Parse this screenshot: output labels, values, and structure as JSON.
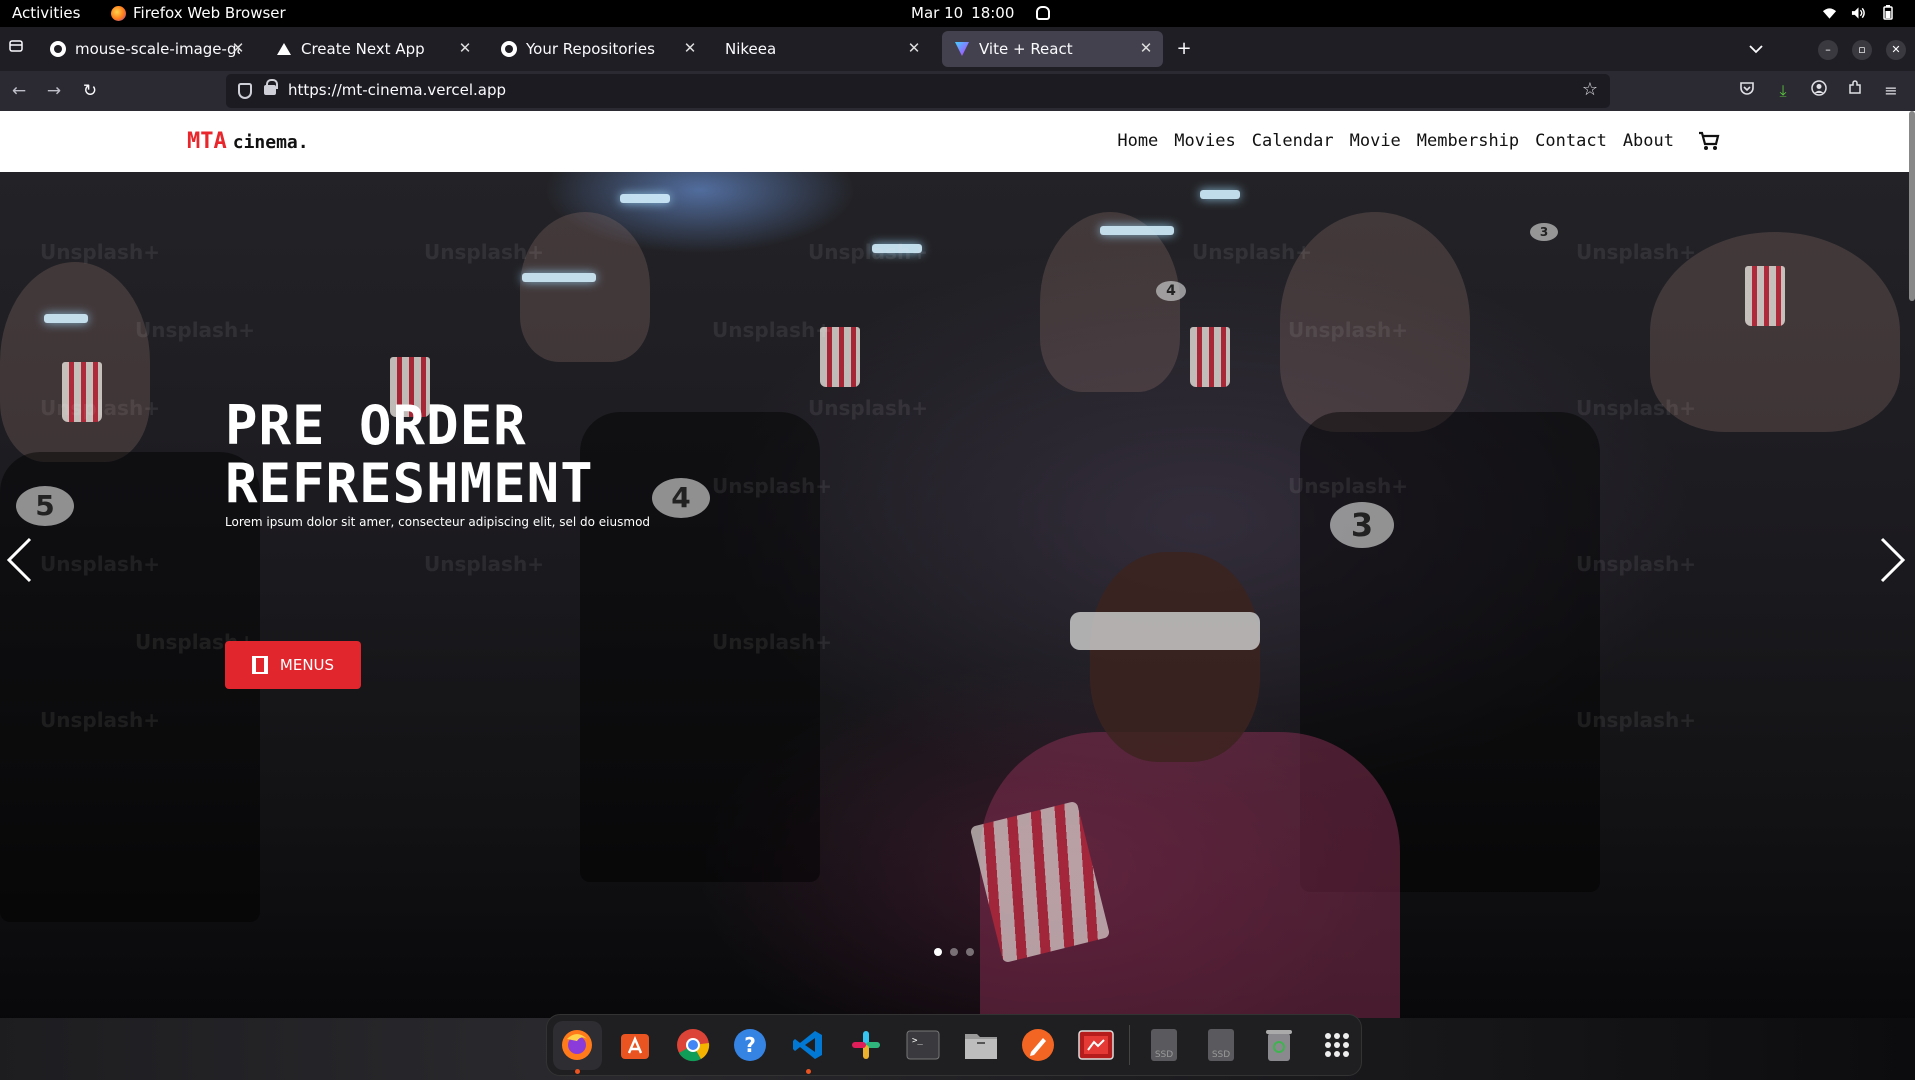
{
  "system_bar": {
    "activities": "Activities",
    "app_name": "Firefox Web Browser",
    "date": "Mar 10",
    "time": "18:00"
  },
  "tabs": [
    {
      "label": "mouse-scale-image-galle",
      "icon": "github-icon",
      "active": false
    },
    {
      "label": "Create Next App",
      "icon": "vercel-icon",
      "active": false
    },
    {
      "label": "Your Repositories",
      "icon": "github-icon",
      "active": false
    },
    {
      "label": "Nikeea",
      "icon": "none",
      "active": false
    },
    {
      "label": "Vite + React",
      "icon": "vite-icon",
      "active": true
    }
  ],
  "address_bar": {
    "url": "https://mt-cinema.vercel.app"
  },
  "site": {
    "logo_primary": "MTA",
    "logo_secondary": "cinema.",
    "nav": [
      "Home",
      "Movies",
      "Calendar",
      "Movie",
      "Membership",
      "Contact",
      "About"
    ],
    "accent_color": "#e2262d"
  },
  "hero": {
    "title_line1": "PRE ORDER",
    "title_line2": "REFRESHMENT",
    "subtitle": "Lorem ipsum dolor sit amer, consecteur adipiscing elit, sel do eiusmod",
    "button_label": "MENUS",
    "slide_count": 3,
    "active_slide": 1,
    "watermark": "Unsplash+",
    "seat_numbers": [
      "5",
      "4",
      "3",
      "4",
      "3"
    ]
  },
  "dock": {
    "items": [
      "firefox",
      "app-center",
      "chrome",
      "help",
      "vscode",
      "slack",
      "terminal",
      "files",
      "pen-tool",
      "media-app",
      "ssd-drive-1",
      "ssd-drive-2",
      "trash",
      "show-apps"
    ]
  }
}
